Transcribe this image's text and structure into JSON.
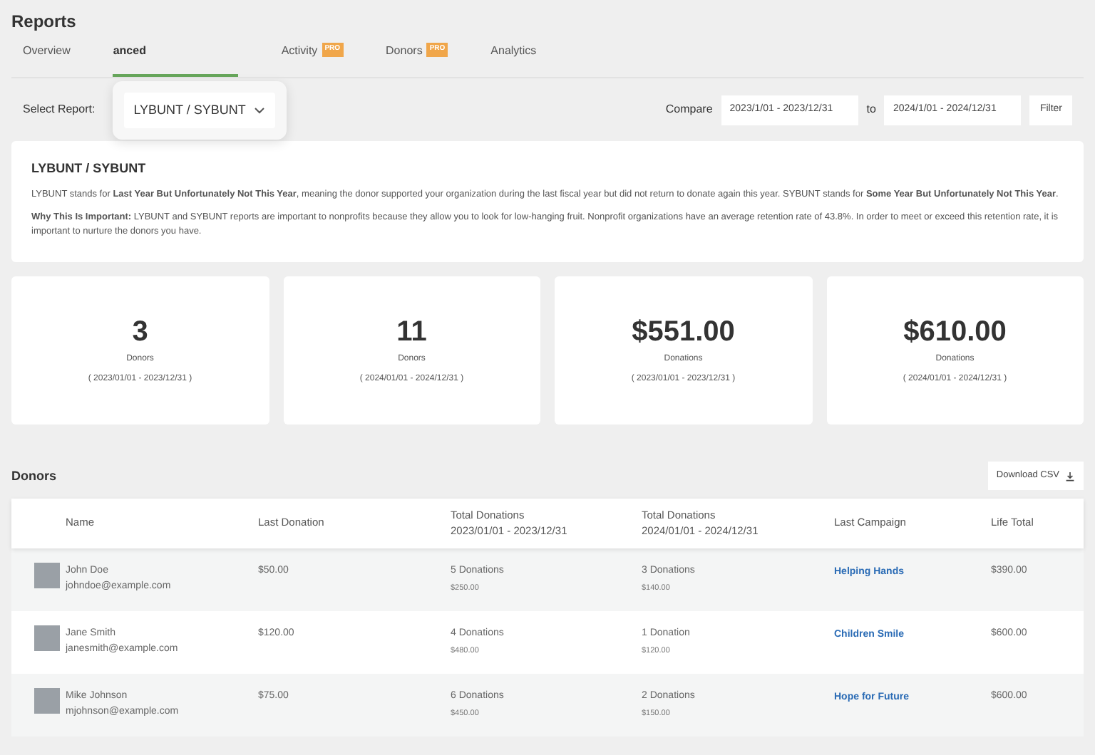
{
  "page": {
    "title": "Reports"
  },
  "tabs": [
    {
      "label": "Overview",
      "selected": false
    },
    {
      "label": "anced",
      "selected": true
    },
    {
      "label": "Activity",
      "selected": false,
      "badge": "PRO"
    },
    {
      "label": "Donors",
      "selected": false,
      "badge": "PRO"
    },
    {
      "label": "Analytics",
      "selected": false
    }
  ],
  "filters": {
    "select_label": "Select Report:",
    "select_value": "LYBUNT / SYBUNT",
    "compare_label": "Compare",
    "from_value": "2023/1/01 - 2023/12/31",
    "to_label": "to",
    "to_value": "2024/1/01 - 2024/12/31",
    "filter_button": "Filter"
  },
  "info": {
    "title": "LYBUNT / SYBUNT",
    "paragraphs": [
      "LYBUNT stands for **Last Year But Unfortunately Not This Year**, meaning the donor supported your organization during the last fiscal year but did not return to donate again this year. SYBUNT stands for **Some Year But Unfortunately Not This Year**.",
      "**Why This Is Important:** LYBUNT and SYBUNT reports are important to nonprofits because they allow you to look for low-hanging fruit. Nonprofit organizations have an average retention rate of 43.8%. In order to meet or exceed this retention rate, it is important to nurture the donors you have."
    ]
  },
  "stats": [
    {
      "value": "3",
      "label": "Donors",
      "period": "( 2023/01/01 - 2023/12/31 )"
    },
    {
      "value": "11",
      "label": "Donors",
      "period": "( 2024/01/01 - 2024/12/31 )"
    },
    {
      "value": "$551.00",
      "label": "Donations",
      "period": "( 2023/01/01 - 2023/12/31 )"
    },
    {
      "value": "$610.00",
      "label": "Donations",
      "period": "( 2024/01/01 - 2024/12/31 )"
    }
  ],
  "donors": {
    "title": "Donors",
    "download_button": "Download CSV",
    "columns": [
      [
        "Name"
      ],
      [
        "Last Donation"
      ],
      [
        "Total Donations",
        "2023/01/01 - 2023/12/31"
      ],
      [
        "Total Donations",
        "2024/01/01 - 2024/12/31"
      ],
      [
        "Last Campaign"
      ],
      [
        "Life Total"
      ]
    ],
    "rows": [
      {
        "name": "John Doe",
        "email": "johndoe@example.com",
        "last_donation": "$50.00",
        "total_1": "5 Donations",
        "amount_1": "$250.00",
        "total_2": "3 Donations",
        "amount_2": "$140.00",
        "campaign": "Helping Hands",
        "life_total": "$390.00"
      },
      {
        "name": "Jane Smith",
        "email": "janesmith@example.com",
        "last_donation": "$120.00",
        "total_1": "4 Donations",
        "amount_1": "$480.00",
        "total_2": "1 Donation",
        "amount_2": "$120.00",
        "campaign": "Children Smile",
        "life_total": "$600.00"
      },
      {
        "name": "Mike Johnson",
        "email": "mjohnson@example.com",
        "last_donation": "$75.00",
        "total_1": "6 Donations",
        "amount_1": "$450.00",
        "total_2": "2 Donations",
        "amount_2": "$150.00",
        "campaign": "Hope for Future",
        "life_total": "$600.00"
      }
    ]
  }
}
